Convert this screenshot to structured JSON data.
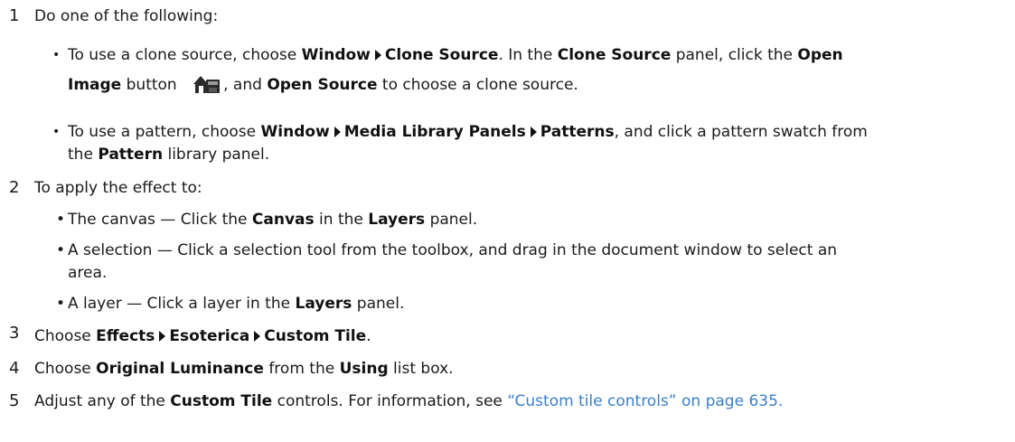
{
  "steps": [
    {
      "number": "1",
      "text": "Do one of the following:",
      "bullets": [
        {
          "part1": "To use a clone source, choose ",
          "menu1": "Window",
          "menu2": "Clone Source",
          "part2": ". In the ",
          "panel": "Clone Source",
          "part3": " panel, click the ",
          "button1a": "Open",
          "button1b": "Image",
          "part4": " button ",
          "icon": "open-image-icon",
          "part5": ", and ",
          "button2": "Open Source",
          "part6": " to choose a clone source."
        },
        {
          "part1": "To use a pattern, choose ",
          "menu1": "Window",
          "menu2": "Media Library Panels",
          "menu3": "Patterns",
          "part2": ", and click a pattern swatch from",
          "part3": "the ",
          "panel": "Pattern",
          "part4": " library panel."
        }
      ]
    },
    {
      "number": "2",
      "text": "To apply the effect to:",
      "bullets": [
        {
          "part1": "The canvas — Click the ",
          "b1": "Canvas",
          "part2": " in the ",
          "b2": "Layers",
          "part3": " panel."
        },
        {
          "part1": "A selection — Click a selection tool from the toolbox, and drag in the document window to select an",
          "part2": "area."
        },
        {
          "part1": "A layer — Click a layer in the ",
          "b1": "Layers",
          "part2": " panel."
        }
      ]
    },
    {
      "number": "3",
      "part1": "Choose ",
      "menu1": "Effects",
      "menu2": "Esoterica",
      "menu3": "Custom Tile",
      "part2": "."
    },
    {
      "number": "4",
      "part1": "Choose ",
      "b1": "Original Luminance",
      "part2": " from the ",
      "b2": "Using",
      "part3": " list box."
    },
    {
      "number": "5",
      "part1": "Adjust any of the ",
      "b1": "Custom Tile",
      "part2": " controls. For information, see ",
      "link": "“Custom tile controls” on page 635."
    }
  ],
  "colors": {
    "link": "#3a7ec9",
    "text": "#1a1a1a"
  }
}
